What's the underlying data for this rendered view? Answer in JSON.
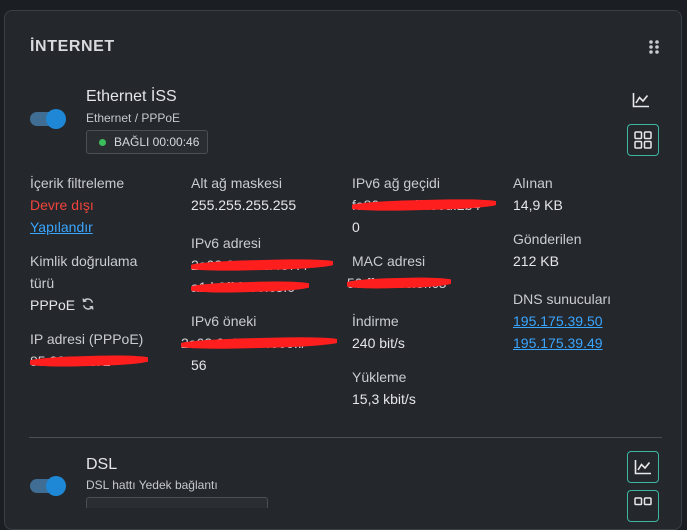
{
  "card": {
    "title": "İNTERNET",
    "drag_icon": "drag-handle-dots-icon"
  },
  "ethernet": {
    "name": "Ethernet İSS",
    "subtitle": "Ethernet / PPPoE",
    "enabled": true,
    "status": "BAĞLI 00:00:46",
    "status_color": "#3bbf5c",
    "chart_icon": "line-chart-icon",
    "grid_icon": "grid-icon",
    "col1": {
      "content_filter_label": "İçerik filtreleme",
      "content_filter_value": "Devre dışı",
      "configure_link": "Yapılandır",
      "auth_label_line1": "Kimlik doğrulama",
      "auth_label_line2": "türü",
      "auth_value": "PPPoE",
      "ip_label": "IP adresi (PPPoE)",
      "ip_value": "85.28.11.172"
    },
    "col2": {
      "mask_label": "Alt ağ maskesi",
      "mask_value": "255.255.255.255",
      "ipv6_label": "IPv6 adresi",
      "ipv6_value_line1": "2a02:6a8:41:4e7:4",
      "ipv6_value_line2": "a1:b3ff:fe80:c5f0",
      "prefix_label": "IPv6 öneki",
      "prefix_value_line1": "2a02:6a8:41:4e00::/",
      "prefix_value_line2": "56"
    },
    "col3": {
      "gateway_label": "IPv6 ağ geçidi",
      "gateway_value_line1": "fe80::e:48ff:fe6d:2b4",
      "gateway_value_line2": "0",
      "mac_label": "MAC adresi",
      "mac_value": "50:ff:20:5c:3f:c3",
      "download_label": "İndirme",
      "download_value": "240 bit/s",
      "upload_label": "Yükleme",
      "upload_value": "15,3 kbit/s"
    },
    "col4": {
      "received_label": "Alınan",
      "received_value": "14,9 KB",
      "sent_label": "Gönderilen",
      "sent_value": "212 KB",
      "dns_label": "DNS sunucuları",
      "dns": [
        "195.175.39.50",
        "195.175.39.49"
      ]
    },
    "colors": {
      "accent": "#1e88d6",
      "disabled": "#f0443c",
      "link": "#3aa6ff",
      "teal": "#3fb5a2"
    }
  },
  "dsl": {
    "name": "DSL",
    "subtitle": "DSL hattı Yedek bağlantı",
    "enabled": true
  }
}
